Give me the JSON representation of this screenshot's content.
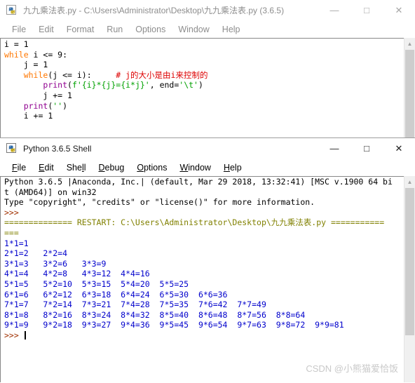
{
  "editor_window": {
    "icon": "python-idle-icon",
    "title": "九九乘法表.py - C:\\Users\\Administrator\\Desktop\\九九乘法表.py (3.6.5)",
    "controls": {
      "minimize": "—",
      "maximize": "□",
      "close": "✕"
    },
    "menu": [
      {
        "label": "File"
      },
      {
        "label": "Edit"
      },
      {
        "label": "Format"
      },
      {
        "label": "Run"
      },
      {
        "label": "Options"
      },
      {
        "label": "Window"
      },
      {
        "label": "Help"
      }
    ],
    "code_lines": [
      {
        "indent": "",
        "tokens": [
          {
            "t": "i = 1",
            "c": "plain"
          }
        ]
      },
      {
        "indent": "",
        "tokens": [
          {
            "t": "while",
            "c": "kw"
          },
          {
            "t": " i <= 9:",
            "c": "plain"
          }
        ]
      },
      {
        "indent": "    ",
        "tokens": [
          {
            "t": "j = 1",
            "c": "plain"
          }
        ]
      },
      {
        "indent": "    ",
        "tokens": [
          {
            "t": "while",
            "c": "kw"
          },
          {
            "t": "(j <= i):",
            "c": "plain"
          },
          {
            "t": "     ",
            "c": "plain"
          },
          {
            "t": "# j的大小是由i来控制的",
            "c": "cmt"
          }
        ]
      },
      {
        "indent": "        ",
        "tokens": [
          {
            "t": "print",
            "c": "bi"
          },
          {
            "t": "(",
            "c": "plain"
          },
          {
            "t": "f'{i}*{j}={i*j}'",
            "c": "str"
          },
          {
            "t": ", end=",
            "c": "plain"
          },
          {
            "t": "'\\t'",
            "c": "str"
          },
          {
            "t": ")",
            "c": "plain"
          }
        ]
      },
      {
        "indent": "        ",
        "tokens": [
          {
            "t": "j += 1",
            "c": "plain"
          }
        ]
      },
      {
        "indent": "    ",
        "tokens": [
          {
            "t": "print",
            "c": "bi"
          },
          {
            "t": "(",
            "c": "plain"
          },
          {
            "t": "''",
            "c": "str"
          },
          {
            "t": ")",
            "c": "plain"
          }
        ]
      },
      {
        "indent": "    ",
        "tokens": [
          {
            "t": "i += 1",
            "c": "plain"
          }
        ]
      }
    ]
  },
  "shell_window": {
    "icon": "python-idle-icon",
    "title": "Python 3.6.5 Shell",
    "controls": {
      "minimize": "—",
      "maximize": "□",
      "close": "✕"
    },
    "menu": [
      {
        "label": "File",
        "mnemonic": "F"
      },
      {
        "label": "Edit",
        "mnemonic": "E"
      },
      {
        "label": "Shell",
        "mnemonic": "l"
      },
      {
        "label": "Debug",
        "mnemonic": "D"
      },
      {
        "label": "Options",
        "mnemonic": "O"
      },
      {
        "label": "Window",
        "mnemonic": "W"
      },
      {
        "label": "Help",
        "mnemonic": "H"
      }
    ],
    "banner_lines": [
      "Python 3.6.5 |Anaconda, Inc.| (default, Mar 29 2018, 13:32:41) [MSC v.1900 64 bi",
      "t (AMD64)] on win32",
      "Type \"copyright\", \"credits\" or \"license()\" for more information."
    ],
    "prompt": ">>>",
    "restart_lines": [
      "============== RESTART: C:\\Users\\Administrator\\Desktop\\九九乘法表.py ===========",
      "==="
    ],
    "output_lines": [
      "1*1=1",
      "2*1=2\t2*2=4",
      "3*1=3\t3*2=6\t3*3=9",
      "4*1=4\t4*2=8\t4*3=12\t4*4=16",
      "5*1=5\t5*2=10\t5*3=15\t5*4=20\t5*5=25",
      "6*1=6\t6*2=12\t6*3=18\t6*4=24\t6*5=30\t6*6=36",
      "7*1=7\t7*2=14\t7*3=21\t7*4=28\t7*5=35\t7*6=42\t7*7=49",
      "8*1=8\t8*2=16\t8*3=24\t8*4=32\t8*5=40\t8*6=48\t8*7=56\t8*8=64",
      "9*1=9\t9*2=18\t9*3=27\t9*4=36\t9*5=45\t9*6=54\t9*7=63\t9*8=72\t9*9=81"
    ],
    "final_prompt": ">>>"
  },
  "watermark": {
    "text": "CSDN @小熊猫爱恰饭"
  },
  "colors": {
    "keyword": "#ff7700",
    "builtin": "#900090",
    "string": "#00a000",
    "comment": "#dd0000",
    "output": "#0000cc",
    "prompt": "#a03000",
    "restart": "#808000"
  }
}
